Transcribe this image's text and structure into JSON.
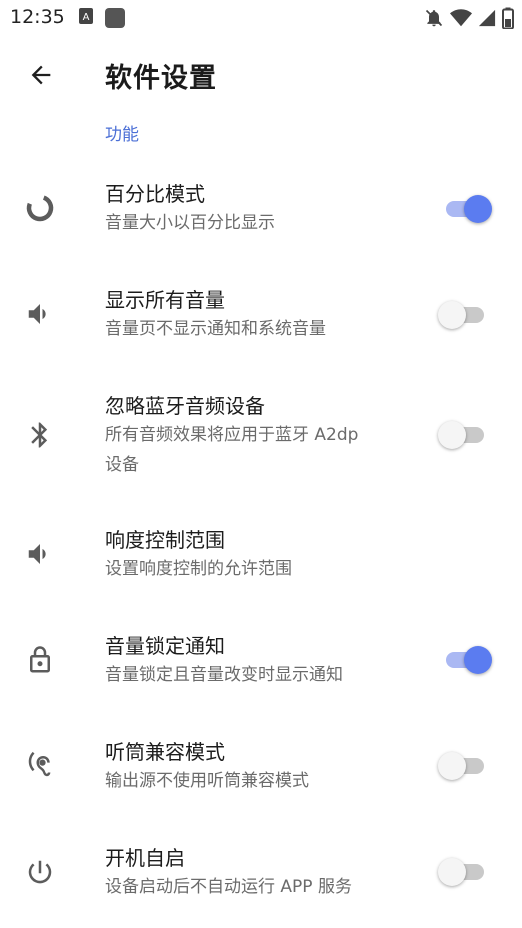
{
  "status_bar": {
    "time": "12:35"
  },
  "app_bar": {
    "title": "软件设置"
  },
  "section": {
    "title": "功能"
  },
  "settings": [
    {
      "title": "百分比模式",
      "summary": "音量大小以百分比显示",
      "icon": "percentage-ring-icon",
      "enabled": true
    },
    {
      "title": "显示所有音量",
      "summary": "音量页不显示通知和系统音量",
      "icon": "volume-icon",
      "enabled": false
    },
    {
      "title": "忽略蓝牙音频设备",
      "summary_line1": "所有音频效果将应用于蓝牙 A2dp",
      "summary_line2": "设备",
      "icon": "bluetooth-icon",
      "enabled": false
    },
    {
      "title": "响度控制范围",
      "summary": "设置响度控制的允许范围",
      "icon": "volume-icon"
    },
    {
      "title": "音量锁定通知",
      "summary": "音量锁定且音量改变时显示通知",
      "icon": "lock-icon",
      "enabled": true
    },
    {
      "title": "听筒兼容模式",
      "summary": "输出源不使用听筒兼容模式",
      "icon": "hearing-icon",
      "enabled": false
    },
    {
      "title": "开机自启",
      "summary": "设备启动后不自动运行 APP 服务",
      "icon": "power-icon",
      "enabled": false
    }
  ],
  "colors": {
    "accent": "#5b7cf0",
    "accent_track": "#aab8f3",
    "section_header": "#4b6fd6"
  }
}
